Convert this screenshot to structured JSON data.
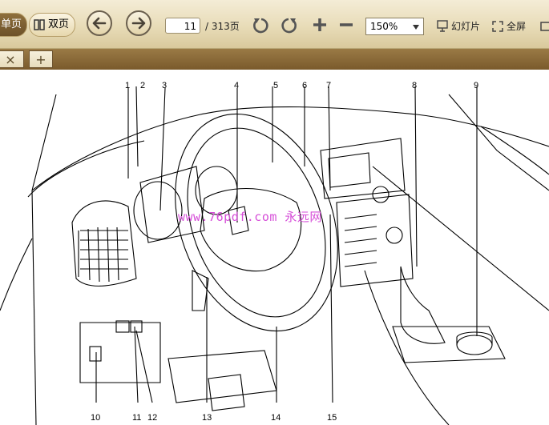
{
  "toolbar": {
    "single_page_label": "单页",
    "double_page_label": "双页",
    "current_page": "11",
    "total_pages": "/ 313页",
    "zoom_value": "150%",
    "slideshow_label": "幻灯片",
    "fullscreen_label": "全屏"
  },
  "tabs": {
    "close_symbol": "×",
    "add_symbol": "+"
  },
  "document": {
    "watermark": "www.76pdf.com 永远网",
    "callouts": [
      "1",
      "2",
      "3",
      "4",
      "5",
      "6",
      "7",
      "8",
      "9",
      "10",
      "11",
      "12",
      "13",
      "14",
      "15"
    ]
  },
  "colors": {
    "toolbar_bg": "#e8dcb8",
    "tabbar_bg": "#8a6a38",
    "watermark": "#d64fd8"
  },
  "icons": [
    "left-arrow-icon",
    "right-arrow-icon",
    "rotate-left-icon",
    "rotate-right-icon",
    "zoom-in-icon",
    "zoom-out-icon",
    "slideshow-icon",
    "fullscreen-icon"
  ]
}
